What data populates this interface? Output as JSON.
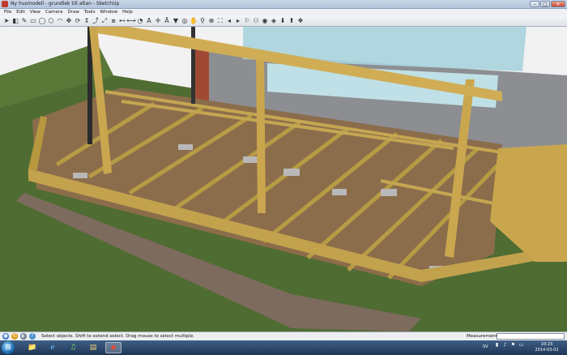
{
  "window": {
    "title": "Ny husmodell - grundlek till altan - SketchUp",
    "minimize_glyph": "–",
    "maximize_glyph": "□",
    "close_glyph": "✕"
  },
  "menu": [
    "File",
    "Edit",
    "View",
    "Camera",
    "Draw",
    "Tools",
    "Window",
    "Help"
  ],
  "toolbar": {
    "tools": [
      {
        "name": "select-arrow-icon",
        "glyph": "➤"
      },
      {
        "name": "eraser-icon",
        "glyph": "◧"
      },
      {
        "name": "pencil-icon",
        "glyph": "✎"
      },
      {
        "name": "rectangle-icon",
        "glyph": "▭"
      },
      {
        "name": "circle-icon",
        "glyph": "◯"
      },
      {
        "name": "polygon-icon",
        "glyph": "⬡"
      },
      {
        "name": "arc-icon",
        "glyph": "◠"
      },
      {
        "name": "move-icon",
        "glyph": "✥"
      },
      {
        "name": "rotate-icon",
        "glyph": "⟳"
      },
      {
        "name": "push-pull-icon",
        "glyph": "⇕"
      },
      {
        "name": "follow-me-icon",
        "glyph": "⤴"
      },
      {
        "name": "scale-icon",
        "glyph": "⤢"
      },
      {
        "name": "offset-icon",
        "glyph": "⧈"
      },
      {
        "name": "tape-measure-icon",
        "glyph": "⊷"
      },
      {
        "name": "dimension-icon",
        "glyph": "⟷"
      },
      {
        "name": "protractor-icon",
        "glyph": "◔"
      },
      {
        "name": "text-icon",
        "glyph": "A"
      },
      {
        "name": "axes-icon",
        "glyph": "✛"
      },
      {
        "name": "3d-text-icon",
        "glyph": "Ā"
      },
      {
        "name": "paint-bucket-icon",
        "glyph": "▼"
      },
      {
        "name": "orbit-icon",
        "glyph": "◎"
      },
      {
        "name": "pan-icon",
        "glyph": "✋"
      },
      {
        "name": "zoom-icon",
        "glyph": "⚲"
      },
      {
        "name": "zoom-window-icon",
        "glyph": "⊕"
      },
      {
        "name": "zoom-extents-icon",
        "glyph": "⛶"
      },
      {
        "name": "previous-view-icon",
        "glyph": "◂"
      },
      {
        "name": "next-view-icon",
        "glyph": "▸"
      },
      {
        "name": "position-camera-icon",
        "glyph": "⚐"
      },
      {
        "name": "walk-icon",
        "glyph": "⚇"
      },
      {
        "name": "look-around-icon",
        "glyph": "◉"
      },
      {
        "name": "section-plane-icon",
        "glyph": "◈"
      },
      {
        "name": "get-models-icon",
        "glyph": "⬇"
      },
      {
        "name": "share-model-icon",
        "glyph": "⬆"
      },
      {
        "name": "components-icon",
        "glyph": "❖"
      }
    ]
  },
  "status": {
    "text": "Select objects. Shift to extend select. Drag mouse to select multiple.",
    "measurements_label": "Measurements",
    "measurements_value": ""
  },
  "taskbar": {
    "start_glyph": "⊞",
    "apps": [
      {
        "name": "taskbar-explorer-icon",
        "glyph": "📁",
        "active": false
      },
      {
        "name": "taskbar-internet-explorer-icon",
        "glyph": "ℯ",
        "active": false
      },
      {
        "name": "taskbar-spotify-icon",
        "glyph": "♫",
        "active": false
      },
      {
        "name": "taskbar-folder-icon",
        "glyph": "▤",
        "active": false
      },
      {
        "name": "taskbar-sketchup-icon",
        "glyph": "◆",
        "active": true
      }
    ],
    "language": "SV",
    "time": "10:23",
    "date": "2014-03-02"
  },
  "colors": {
    "grass": "#4e6b31",
    "soil": "#8a6c4a",
    "joist": "#b59a45",
    "post": "#c9a64d",
    "glass": "#9fcfd8",
    "brick": "#a04a35",
    "gravel": "#7c6a5c"
  }
}
